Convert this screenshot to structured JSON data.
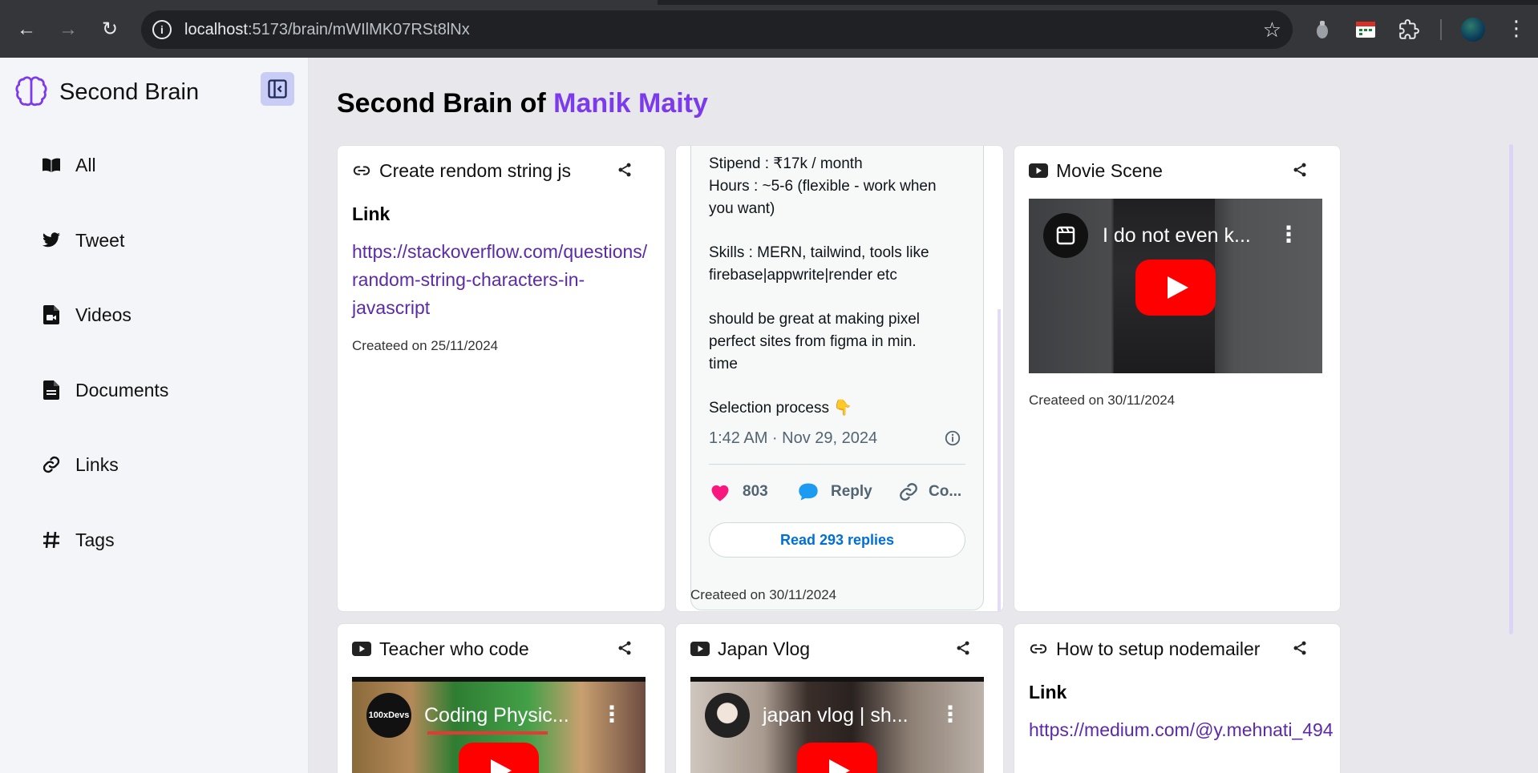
{
  "browser": {
    "url_host": "localhost",
    "url_path": ":5173/brain/mWIlMK07RSt8lNx"
  },
  "sidebar": {
    "brand": "Second Brain",
    "items": [
      {
        "label": "All",
        "icon": "book-icon"
      },
      {
        "label": "Tweet",
        "icon": "twitter-icon"
      },
      {
        "label": "Videos",
        "icon": "video-file-icon"
      },
      {
        "label": "Documents",
        "icon": "document-icon"
      },
      {
        "label": "Links",
        "icon": "link-icon"
      },
      {
        "label": "Tags",
        "icon": "hash-icon"
      }
    ]
  },
  "header": {
    "title_prefix": "Second Brain of",
    "owner": "Manik Maity"
  },
  "cards": {
    "c1": {
      "title": "Create rendom string js",
      "link_heading": "Link",
      "url_lines": [
        "https://stackoverflow.com/questions/",
        "random-string-characters-in-",
        "javascript"
      ],
      "created": "Createed on 25/11/2024"
    },
    "c2": {
      "tweet_lines": [
        "Stipend : ₹17k / month",
        "Hours : ~5-6 (flexible - work when",
        "you want)",
        "Skills : MERN, tailwind, tools like",
        "firebase|appwrite|render etc",
        "should be great at making pixel",
        "perfect sites from figma in min.",
        "time",
        "Selection process 👇"
      ],
      "timestamp": "1:42 AM · Nov 29, 2024",
      "likes": "803",
      "reply": "Reply",
      "copy": "Co...",
      "read_replies": "Read 293 replies",
      "created": "Createed on 30/11/2024"
    },
    "c3": {
      "title": "Movie Scene",
      "video_title": "I do not even k...",
      "created": "Createed on 30/11/2024"
    },
    "c4": {
      "title": "Teacher who code",
      "video_title": "Coding Physic...",
      "channel": "100xDevs"
    },
    "c5": {
      "title": "Japan Vlog",
      "video_title": "japan vlog | sh..."
    },
    "c6": {
      "title": "How to setup nodemailer",
      "link_heading": "Link",
      "url_line": "https://medium.com/@y.mehnati_494"
    }
  },
  "colors": {
    "accent": "#7c3aed",
    "link": "#5b2aa8",
    "sidebar_bg": "#f4f5f8",
    "page_bg": "#e8e8ec",
    "youtube_red": "#ff0000",
    "twitter_blue": "#1d9bf0",
    "heart_pink": "#f91880"
  }
}
